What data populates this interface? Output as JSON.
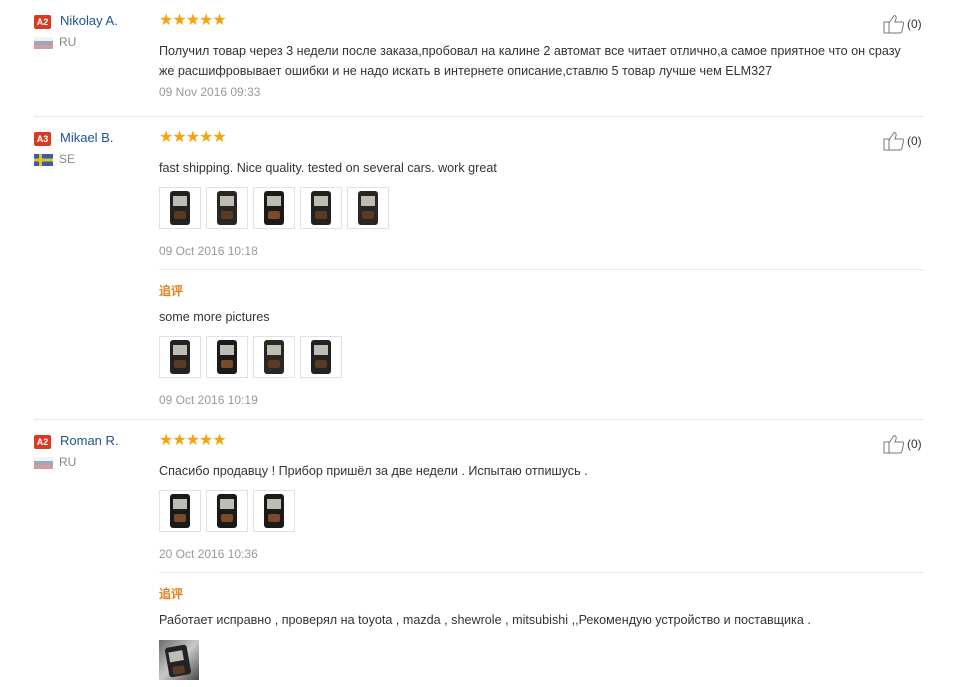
{
  "helpful_label_template": "(count)",
  "reviews": [
    {
      "badge": "A2",
      "name": "Nikolay A.",
      "country": "RU",
      "stars": "★★★★★",
      "helpful": "(0)",
      "text": "Получил товар через 3 недели после заказа,пробовал на калине 2 автомат все читает отлично,а самое приятное что он сразу же расшифровывает ошибки и не надо искать в интернете описание,ставлю 5 товар лучше чем ELM327",
      "date": "09 Nov 2016 09:33"
    },
    {
      "badge": "A3",
      "name": "Mikael B.",
      "country": "SE",
      "stars": "★★★★★",
      "helpful": "(0)",
      "text": "fast shipping. Nice quality. tested on several cars. work great",
      "image_count": 5,
      "date": "09 Oct 2016 10:18",
      "followup": {
        "label": "追评",
        "text": "some more pictures",
        "image_count": 4,
        "date": "09 Oct 2016 10:19"
      }
    },
    {
      "badge": "A2",
      "name": "Roman R.",
      "country": "RU",
      "stars": "★★★★★",
      "helpful": "(0)",
      "text": "Спасибо продавцу ! Прибор пришёл за две недели . Испытаю отпишусь .",
      "image_count": 3,
      "date": "20 Oct 2016 10:36",
      "followup": {
        "label": "追评",
        "text": "Работает исправно , проверял на toyota , mazda , shewrole , mitsubishi ,,Рекомендую устройство и поставщика .",
        "image_count": 1
      }
    }
  ],
  "colors": {
    "star": "#f5a30f",
    "badge": "#d83b1f",
    "name": "#20558f",
    "followup_label": "#e3811c"
  },
  "icons": {
    "helpful": "thumbs-up-icon",
    "flag_ru": "russia-flag-icon",
    "flag_se": "sweden-flag-icon"
  }
}
